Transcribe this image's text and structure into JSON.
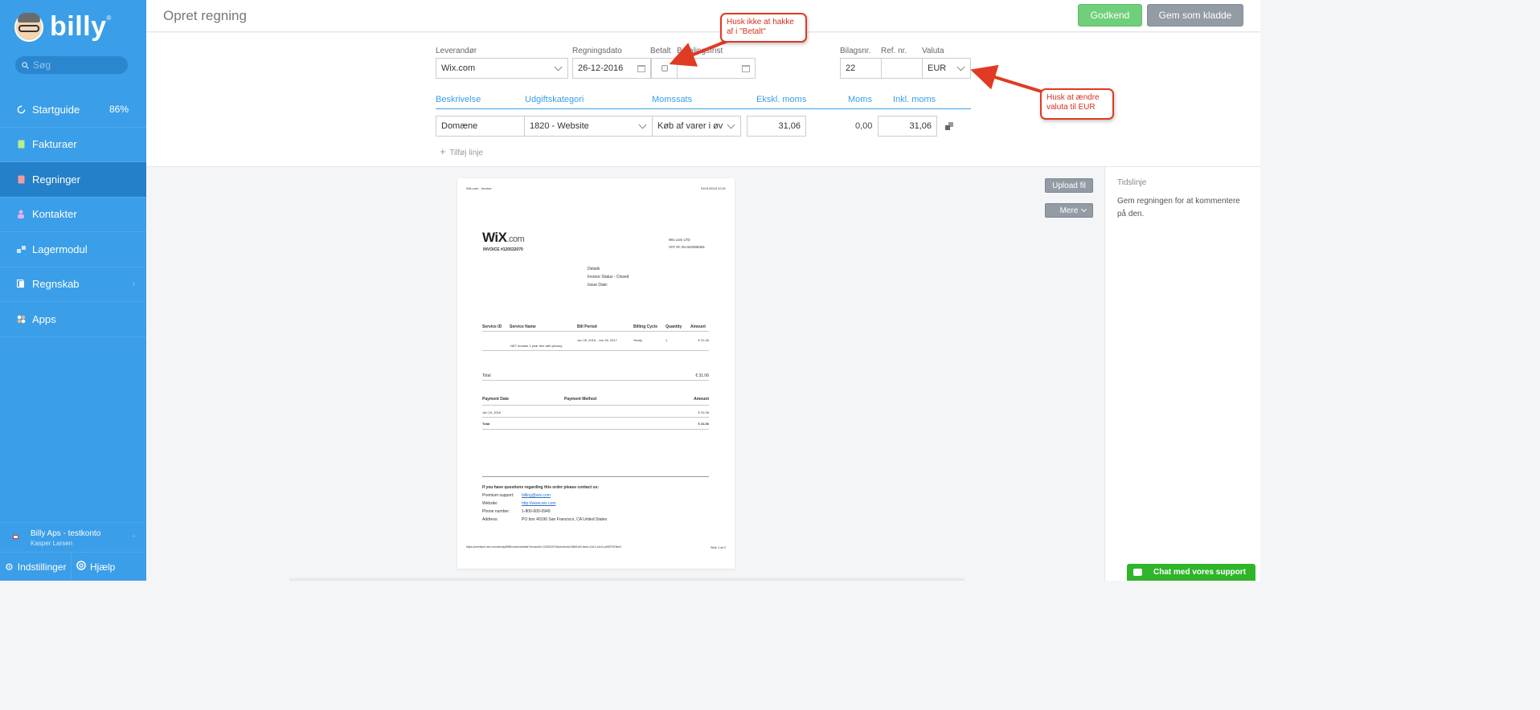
{
  "app": {
    "name": "billy",
    "trademark": "®"
  },
  "search": {
    "placeholder": "Søg"
  },
  "sidebar": {
    "items": [
      {
        "label": "Startguide",
        "extra": "86%",
        "icon": "startguide-icon"
      },
      {
        "label": "Fakturaer",
        "icon": "invoice-icon"
      },
      {
        "label": "Regninger",
        "icon": "bill-icon",
        "active": true
      },
      {
        "label": "Kontakter",
        "icon": "contacts-icon"
      },
      {
        "label": "Lagermodul",
        "icon": "inventory-icon"
      },
      {
        "label": "Regnskab",
        "icon": "accounting-icon",
        "has_submenu": true
      },
      {
        "label": "Apps",
        "icon": "apps-icon"
      }
    ],
    "account": {
      "name": "Billy Aps - testkonto",
      "user": "Kasper Larsen"
    },
    "settings_label": "Indstillinger",
    "help_label": "Hjælp"
  },
  "header": {
    "title": "Opret regning",
    "approve_label": "Godkend",
    "draft_label": "Gem som kladde"
  },
  "form": {
    "supplier_label": "Leverandør",
    "supplier_value": "Wix.com",
    "date_label": "Regningsdato",
    "date_value": "26-12-2016",
    "paid_label": "Betalt",
    "due_label": "Betalingsfrist",
    "due_value": "",
    "voucher_label": "Bilagsnr.",
    "voucher_value": "22",
    "ref_label": "Ref. nr.",
    "ref_value": "",
    "currency_label": "Valuta",
    "currency_value": "EUR"
  },
  "lines": {
    "headers": [
      "Beskrivelse",
      "Udgiftskategori",
      "Momssats",
      "Ekskl. moms",
      "Moms",
      "Inkl. moms"
    ],
    "rows": [
      {
        "description": "Domæne",
        "category": "1820 - Website",
        "vat_rate": "Køb af varer i øv",
        "excl": "31,06",
        "vat": "0,00",
        "incl": "31,06"
      }
    ],
    "add_line_label": "Tilføj linje"
  },
  "callouts": {
    "paid": "Husk ikke at hakke af i \"Betalt\"",
    "currency": "Husk at ændre valuta til EUR"
  },
  "document": {
    "top_left": "Wix.com - Invoice",
    "top_right": "01/01/2018 22:51",
    "logo_main": "WiX",
    "logo_suffix": ".com",
    "invoice_no": "INVOICE #120532070",
    "company": "Wix.com LTD",
    "vat_id": "VAT ID: EU442008451",
    "details_title": "Details",
    "status": "Invoice Status - Closed",
    "issue_date": "Issue Date:",
    "table_headers": [
      "Service ID",
      "Service Name",
      "Bill Period",
      "Billing Cycle",
      "Quantity",
      "Amount"
    ],
    "row_period": "Jun 26, 2016 - Jun 26, 2017",
    "row_cycle": "Yearly",
    "row_qty": "1",
    "row_amount": "€ 31.06",
    "row_name": ".NET domain 1 year free with privacy",
    "total_label": "Total",
    "total_value": "€ 31.06",
    "pay_headers": [
      "Payment Date",
      "Payment Method",
      "Amount"
    ],
    "pay_date": "Jun 24, 2016",
    "pay_amount": "€ 31.06",
    "pay_total_label": "Total",
    "pay_total_value": "€ 31.06",
    "contact_title": "If you have questions regarding this order please contact us:",
    "premium_label": "Premium support:",
    "premium_value": "billing@wix.com",
    "website_label": "Website:",
    "website_value": "http://www.wix.com",
    "phone_label": "Phone number:",
    "phone_value": "1-800-600-0949",
    "address_label": "Address:",
    "address_value": "PO box 40190 San Francisco, CA United States",
    "footer_url": "https://premium.wix.com/wix/api/BillInvoice/details?invoiceId=120532070&serviceId=8861bf0-6ebc-41d7-a1c3-ca9f37576ee9",
    "footer_page": "Side 1 af 2"
  },
  "side_actions": {
    "upload_label": "Upload fil",
    "more_label": "Mere"
  },
  "timeline": {
    "title": "Tidslinje",
    "text": "Gem regningen for at kommentere på den."
  },
  "chat": {
    "label": "Chat med vores support"
  },
  "colors": {
    "sidebar": "#3b9ee8",
    "sidebar_active": "#2480c8",
    "approve": "#6fcf7a",
    "draft": "#939ba5",
    "callout_red": "#e03a22",
    "chat": "#2fb52a"
  }
}
